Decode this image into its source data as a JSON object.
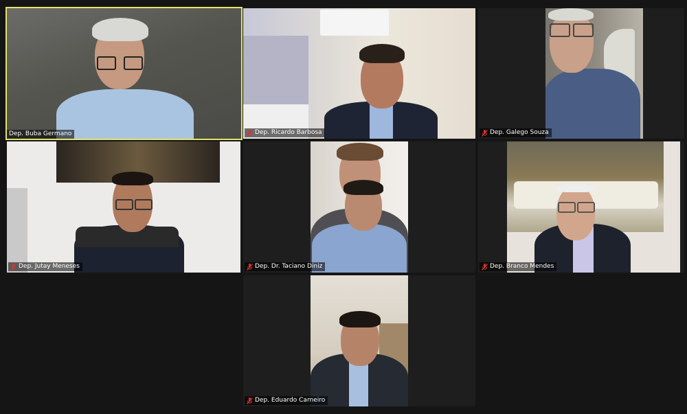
{
  "meeting": {
    "participants": [
      {
        "name": "Dep. Buba Germano",
        "muted": false,
        "active_speaker": true
      },
      {
        "name": "Dep. Ricardo Barbosa",
        "muted": true,
        "active_speaker": false
      },
      {
        "name": "Dep. Galego Souza",
        "muted": true,
        "active_speaker": false
      },
      {
        "name": "Dep. Jutay Meneses",
        "muted": true,
        "active_speaker": false
      },
      {
        "name": "Dep. Dr. Taciano Diniz",
        "muted": true,
        "active_speaker": false
      },
      {
        "name": "Dep. Branco Mendes",
        "muted": true,
        "active_speaker": false
      },
      {
        "name": "Dep. Eduardo Carneiro",
        "muted": true,
        "active_speaker": false
      }
    ]
  },
  "colors": {
    "active_speaker_border": "#e3e36a",
    "muted_icon": "#e0302f",
    "background": "#151515"
  },
  "icons": {
    "muted": "muted-mic-icon"
  }
}
